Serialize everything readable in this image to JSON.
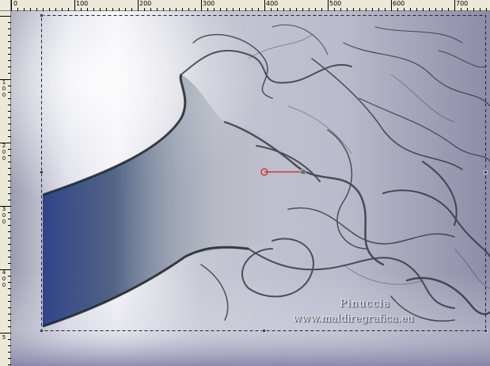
{
  "ruler": {
    "top_ticks": [
      "0",
      "100",
      "200",
      "300",
      "400",
      "500",
      "600",
      "700"
    ],
    "left_ticks": [
      "1\n0\n0",
      "2\n0\n0",
      "3\n0\n0",
      "4\n0\n0",
      "5"
    ]
  },
  "image": {
    "watermark_line1": "Pinuccia",
    "watermark_line2": "www.maldiregrafica.eu"
  },
  "colors": {
    "selection": "#202030",
    "marker": "#d02020"
  }
}
